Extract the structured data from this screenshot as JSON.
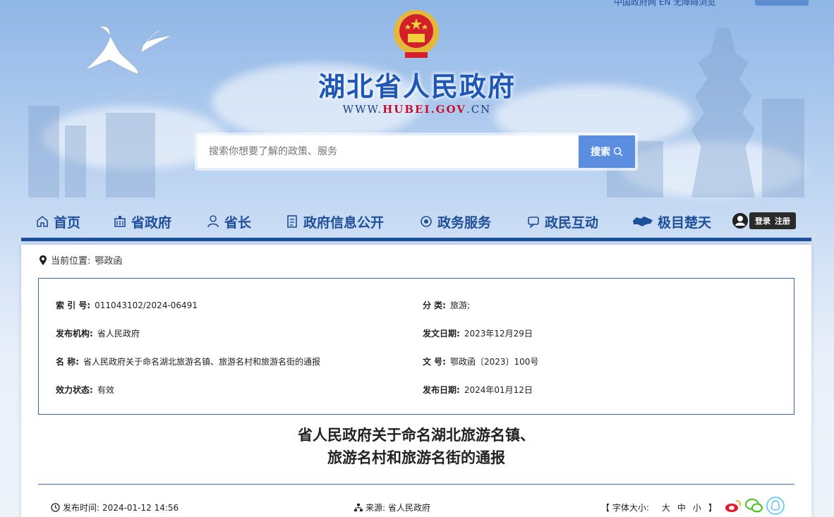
{
  "top_links": "中国政府网 EN   无障碍浏览",
  "site": {
    "title": "湖北省人民政府",
    "url_prefix": "WWW.",
    "url_domain": "HUBEI.GOV",
    "url_suffix": ".CN"
  },
  "search": {
    "placeholder": "搜索你想要了解的政策、服务",
    "button_label": "搜索"
  },
  "nav": [
    {
      "label": "首页",
      "icon": "home-icon"
    },
    {
      "label": "省政府",
      "icon": "building-icon"
    },
    {
      "label": "省长",
      "icon": "person-icon"
    },
    {
      "label": "政府信息公开",
      "icon": "document-icon"
    },
    {
      "label": "政务服务",
      "icon": "service-icon"
    },
    {
      "label": "政民互动",
      "icon": "chat-icon"
    },
    {
      "label": "极目楚天",
      "icon": "map-icon"
    }
  ],
  "auth": {
    "login": "登录",
    "register": "注册"
  },
  "breadcrumb": {
    "label": "当前位置:",
    "current": "鄂政函"
  },
  "meta": {
    "index_no_label": "索 引 号:",
    "index_no": "011043102/2024-06491",
    "category_label": "分    类:",
    "category": "旅游;",
    "issuer_label": "发布机构:",
    "issuer": "省人民政府",
    "doc_date_label": "发文日期:",
    "doc_date": "2023年12月29日",
    "name_label": "名    称:",
    "name": "省人民政府关于命名湖北旅游名镇、旅游名村和旅游名街的通报",
    "doc_no_label": "文    号:",
    "doc_no": "鄂政函〔2023〕100号",
    "status_label": "效力状态:",
    "status": "有效",
    "publish_date_label": "发布日期:",
    "publish_date": "2024年01月12日"
  },
  "doc": {
    "title_line1": "省人民政府关于命名湖北旅游名镇、",
    "title_line2": "旅游名村和旅游名街的通报",
    "publish_time_label": "发布时间:",
    "publish_time": "2024-01-12 14:56",
    "source_label": "来源:",
    "source": "省人民政府",
    "font_size_label": "【 字体大小:",
    "font_large": "大",
    "font_medium": "中",
    "font_small": "小",
    "font_close": "】"
  },
  "colors": {
    "brand_blue": "#1f4f9a",
    "button_blue": "#5b8ee0",
    "border_blue": "#3c66b4"
  }
}
